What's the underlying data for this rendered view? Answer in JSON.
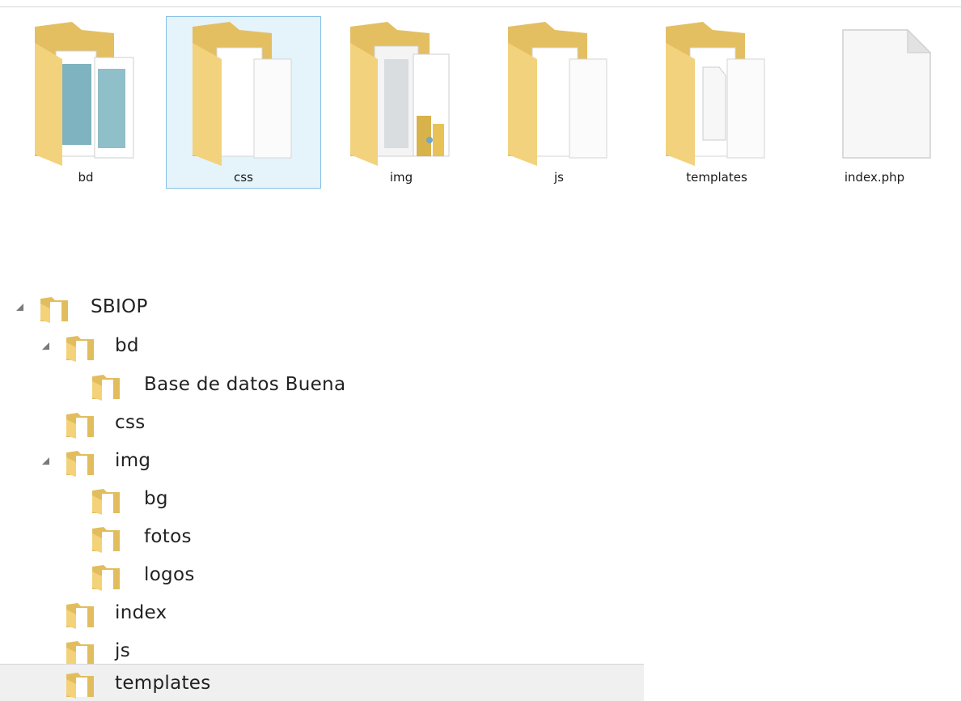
{
  "icons": [
    {
      "label": "bd",
      "type": "folder-notebooks",
      "selected": false
    },
    {
      "label": "css",
      "type": "folder-papers",
      "selected": true
    },
    {
      "label": "img",
      "type": "folder-images",
      "selected": false
    },
    {
      "label": "js",
      "type": "folder-papers",
      "selected": false
    },
    {
      "label": "templates",
      "type": "folder-papers",
      "selected": false
    },
    {
      "label": "index.php",
      "type": "file-blank",
      "selected": false
    }
  ],
  "tree": [
    {
      "label": "SBIOP",
      "level": 0,
      "expanded": true
    },
    {
      "label": "bd",
      "level": 1,
      "expanded": true
    },
    {
      "label": "Base de datos Buena",
      "level": 2,
      "expanded": false
    },
    {
      "label": "css",
      "level": 1,
      "expanded": false
    },
    {
      "label": "img",
      "level": 1,
      "expanded": true
    },
    {
      "label": "bg",
      "level": 2,
      "expanded": false
    },
    {
      "label": "fotos",
      "level": 2,
      "expanded": false
    },
    {
      "label": "logos",
      "level": 2,
      "expanded": false
    },
    {
      "label": "index",
      "level": 1,
      "expanded": false
    },
    {
      "label": "js",
      "level": 1,
      "expanded": false
    },
    {
      "label": "templates",
      "level": 1,
      "expanded": false,
      "highlighted": true
    }
  ]
}
